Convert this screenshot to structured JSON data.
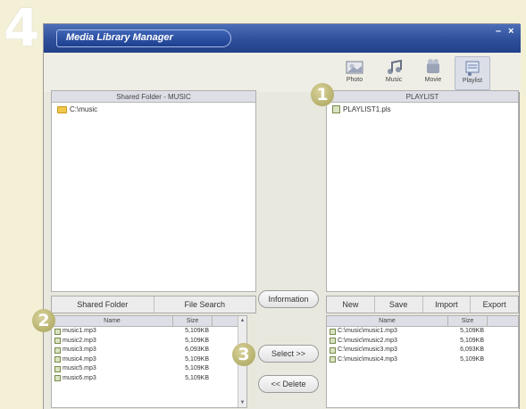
{
  "step_number": "4",
  "window": {
    "title": "Media Library Manager",
    "minimize": "–",
    "close": "×"
  },
  "modes": [
    {
      "label": "Photo",
      "icon": "photo-icon"
    },
    {
      "label": "Music",
      "icon": "music-icon"
    },
    {
      "label": "Movie",
      "icon": "movie-icon"
    },
    {
      "label": "Playlist",
      "icon": "playlist-icon"
    }
  ],
  "left_panel": {
    "header": "Shared Folder - MUSIC",
    "folder": "C:\\music"
  },
  "right_panel": {
    "header": "PLAYLIST",
    "item": "PLAYLIST1.pls"
  },
  "left_tabs": {
    "shared_folder": "Shared Folder",
    "file_search": "File Search"
  },
  "middle": {
    "information": "Information",
    "select": "Select >>",
    "delete": "<< Delete"
  },
  "right_tabs": {
    "new": "New",
    "save": "Save",
    "import": "Import",
    "export": "Export"
  },
  "left_table": {
    "columns": [
      "Name",
      "Size"
    ],
    "rows": [
      {
        "name": "music1.mp3",
        "size": "5,109KB"
      },
      {
        "name": "music2.mp3",
        "size": "5,109KB"
      },
      {
        "name": "music3.mp3",
        "size": "6,093KB"
      },
      {
        "name": "music4.mp3",
        "size": "5,109KB"
      },
      {
        "name": "music5.mp3",
        "size": "5,109KB"
      },
      {
        "name": "music6.mp3",
        "size": "5,109KB"
      }
    ]
  },
  "right_table": {
    "columns": [
      "Name",
      "Size"
    ],
    "rows": [
      {
        "name": "C:\\music\\music1.mp3",
        "size": "5,109KB"
      },
      {
        "name": "C:\\music\\music2.mp3",
        "size": "5,109KB"
      },
      {
        "name": "C:\\music\\music3.mp3",
        "size": "6,093KB"
      },
      {
        "name": "C:\\music\\music4.mp3",
        "size": "5,109KB"
      }
    ]
  },
  "badges": [
    "1",
    "2",
    "3"
  ]
}
